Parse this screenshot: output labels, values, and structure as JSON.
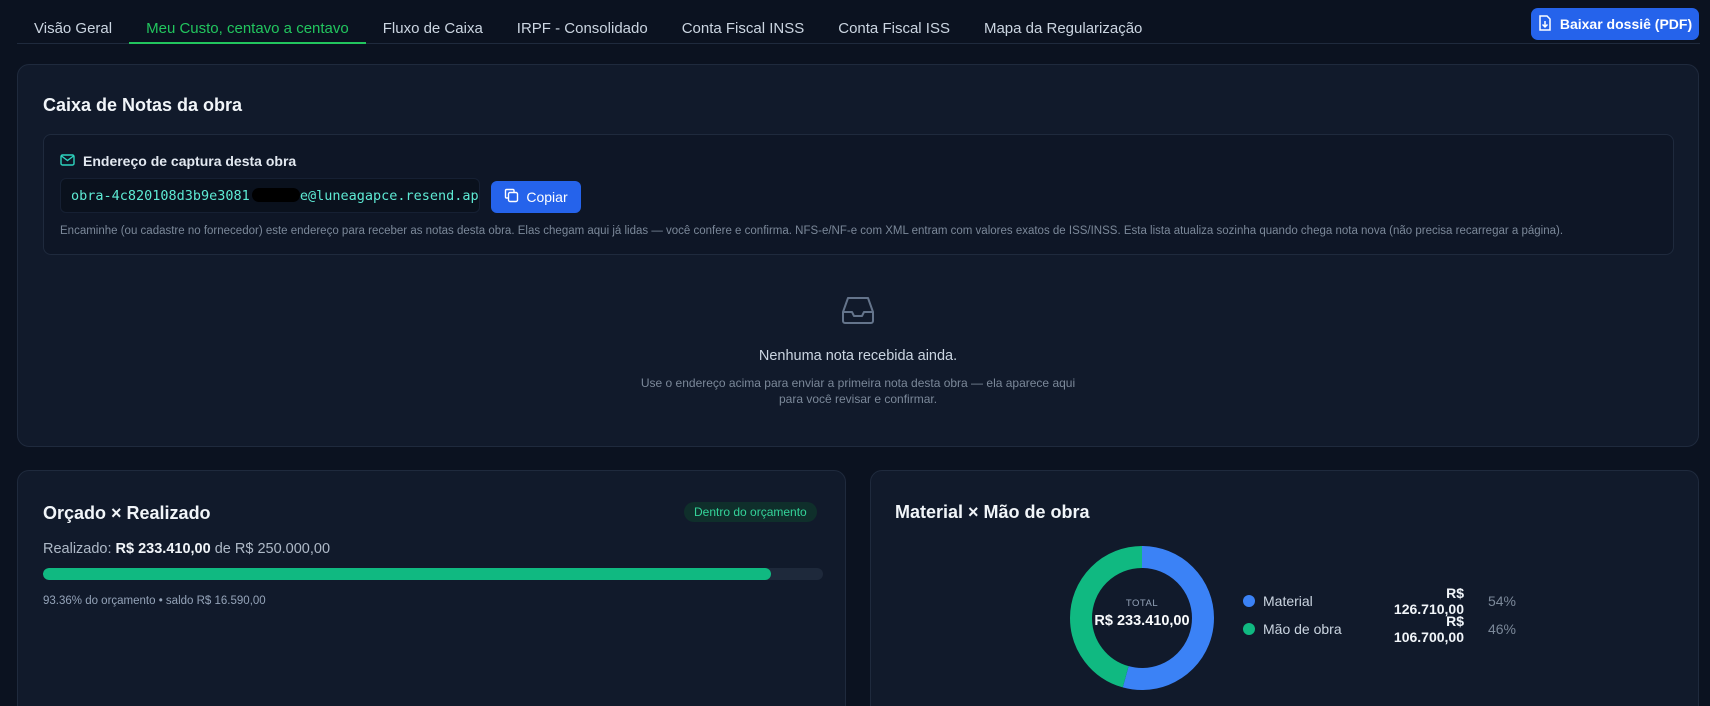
{
  "tabs": [
    {
      "label": "Visão Geral",
      "active": false
    },
    {
      "label": "Meu Custo, centavo a centavo",
      "active": true
    },
    {
      "label": "Fluxo de Caixa",
      "active": false
    },
    {
      "label": "IRPF - Consolidado",
      "active": false
    },
    {
      "label": "Conta Fiscal INSS",
      "active": false
    },
    {
      "label": "Conta Fiscal ISS",
      "active": false
    },
    {
      "label": "Mapa da Regularização",
      "active": false
    }
  ],
  "header": {
    "download_label": "Baixar dossiê (PDF)"
  },
  "caixa": {
    "title": "Caixa de Notas da obra",
    "capture_label": "Endereço de captura desta obra",
    "email_prefix": "obra-4c820108d3b9e3081",
    "email_suffix": "e@luneagapce.resend.app",
    "copy_label": "Copiar",
    "description": "Encaminhe (ou cadastre no fornecedor) este endereço para receber as notas desta obra. Elas chegam aqui já lidas — você confere e confirma. NFS-e/NF-e com XML entram com valores exatos de ISS/INSS. Esta lista atualiza sozinha quando chega nota nova (não precisa recarregar a página).",
    "empty_title": "Nenhuma nota recebida ainda.",
    "empty_sub": "Use o endereço acima para enviar a primeira nota desta obra — ela aparece aqui para você revisar e confirmar."
  },
  "orcado": {
    "title": "Orçado × Realizado",
    "badge": "Dentro do orçamento",
    "realizado_prefix": "Realizado:",
    "realizado_value": "R$ 233.410,00",
    "realizado_mid": "de",
    "budget_value": "R$ 250.000,00",
    "progress_fraction": 0.9336,
    "note": "93.36% do orçamento • saldo R$ 16.590,00"
  },
  "material": {
    "title": "Material × Mão de obra",
    "total_label": "TOTAL",
    "total_value": "R$ 233.410,00",
    "items": [
      {
        "name": "Material",
        "value": "R$ 126.710,00",
        "pct": "54%",
        "fraction": 0.5429,
        "color": "#3b82f6"
      },
      {
        "name": "Mão de obra",
        "value": "R$ 106.700,00",
        "pct": "46%",
        "fraction": 0.4571,
        "color": "#10b981"
      }
    ]
  }
}
